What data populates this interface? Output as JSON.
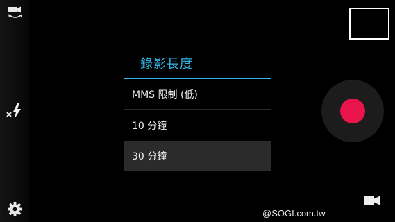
{
  "left_toolbar": {
    "icons": [
      "switch-camera-icon",
      "flash-off-icon",
      "settings-gear-icon"
    ]
  },
  "video_length_menu": {
    "title": "錄影長度",
    "items": [
      {
        "label": "MMS 限制 (低)",
        "selected": false
      },
      {
        "label": "10 分鐘",
        "selected": false
      },
      {
        "label": "30 分鐘",
        "selected": true
      }
    ]
  },
  "right_controls": {
    "icons": [
      "thumbnail-preview",
      "record-button",
      "video-mode-icon"
    ]
  },
  "watermark": {
    "text": "@SOGI.com.tw"
  },
  "colors": {
    "accent": "#33b5e5",
    "record": "#e8144b",
    "selected_item": "#2b2b2b"
  }
}
